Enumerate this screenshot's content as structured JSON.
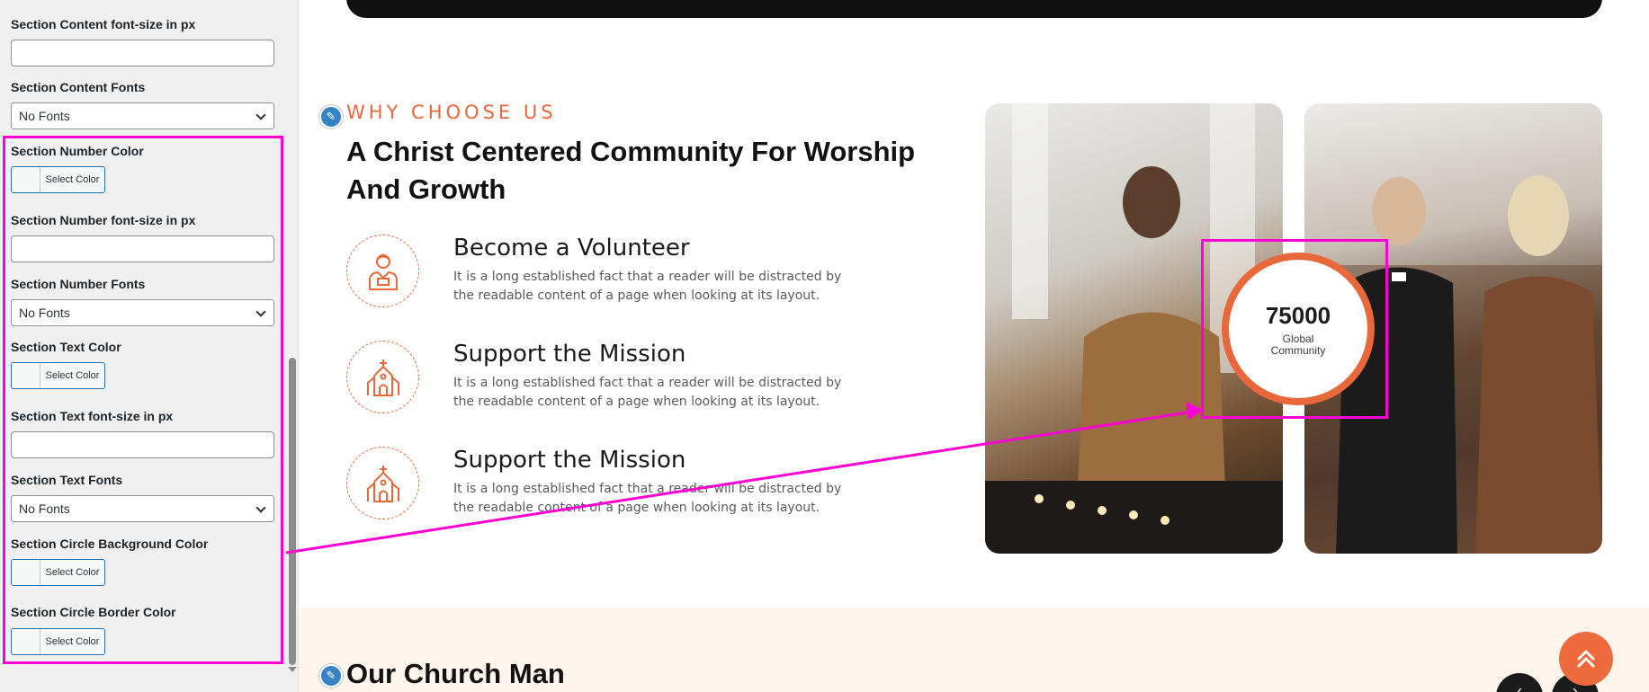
{
  "sidebar": {
    "controls": [
      {
        "label": "Section Content font-size in px",
        "type": "input",
        "value": ""
      },
      {
        "label": "Section Content Fonts",
        "type": "select",
        "value": "No Fonts"
      },
      {
        "label": "Section Number Color",
        "type": "color",
        "button_text": "Select Color"
      },
      {
        "label": "Section Number font-size in px",
        "type": "input",
        "value": ""
      },
      {
        "label": "Section Number Fonts",
        "type": "select",
        "value": "No Fonts"
      },
      {
        "label": "Section Text Color",
        "type": "color",
        "button_text": "Select Color"
      },
      {
        "label": "Section Text font-size in px",
        "type": "input",
        "value": ""
      },
      {
        "label": "Section Text Fonts",
        "type": "select",
        "value": "No Fonts"
      },
      {
        "label": "Section Circle Background Color",
        "type": "color",
        "button_text": "Select Color"
      },
      {
        "label": "Section Circle Border Color",
        "type": "color",
        "button_text": "Select Color"
      }
    ]
  },
  "preview": {
    "tagline": "WHY CHOOSE US",
    "heading": "A Christ Centered Community For Worship And Growth",
    "features": [
      {
        "icon": "volunteer-icon",
        "title": "Become a Volunteer",
        "desc": "It is a long established fact that a reader will be distracted by the readable content of a page when looking at its layout."
      },
      {
        "icon": "church-icon",
        "title": "Support the Mission",
        "desc": "It is a long established fact that a reader will be distracted by the readable content of a page when looking at its layout."
      },
      {
        "icon": "church-icon",
        "title": "Support the Mission",
        "desc": "It is a long established fact that a reader will be distracted by the readable content of a page when looking at its layout."
      }
    ],
    "stat": {
      "number": "75000",
      "label": "Global Community"
    },
    "section2_title": "Our Church Man"
  },
  "colors": {
    "accent": "#e8673b",
    "highlight": "#ff00d4",
    "edit_icon": "#3582c4",
    "bottom_band": "#fdf5ec"
  }
}
